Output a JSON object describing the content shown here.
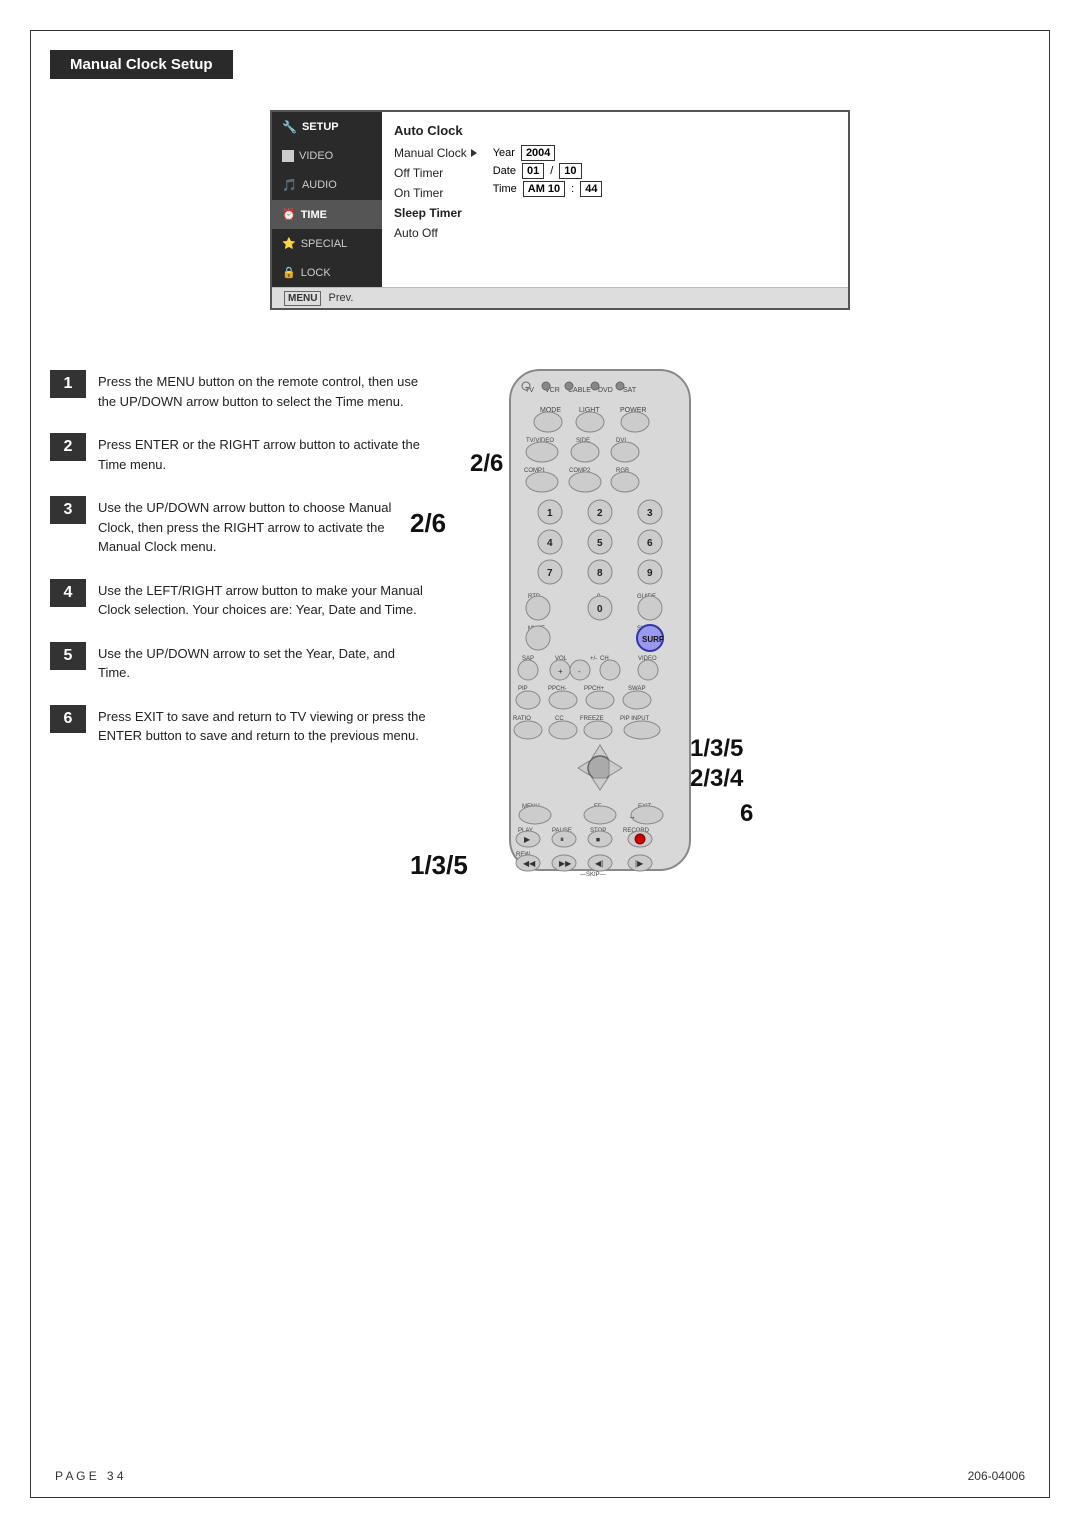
{
  "page": {
    "title": "Manual Clock Setup",
    "footer": {
      "page_label": "P A G E",
      "page_number": "3 4",
      "doc_number": "206-04006"
    }
  },
  "tv_menu": {
    "sidebar_items": [
      {
        "icon": "wrench",
        "label": "SETUP",
        "active": false
      },
      {
        "icon": "square",
        "label": "VIDEO",
        "active": false
      },
      {
        "icon": "audio",
        "label": "AUDIO",
        "active": false
      },
      {
        "icon": "clock",
        "label": "TIME",
        "active": true
      },
      {
        "icon": "special",
        "label": "SPECIAL",
        "active": false
      },
      {
        "icon": "lock",
        "label": "LOCK",
        "active": false
      }
    ],
    "menu_items": [
      {
        "label": "Auto Clock",
        "bold": true,
        "selected": false
      },
      {
        "label": "Manual Clock",
        "bold": false,
        "selected": true,
        "arrow": true
      },
      {
        "label": "Off Timer",
        "bold": false,
        "selected": false
      },
      {
        "label": "On Timer",
        "bold": false,
        "selected": false
      },
      {
        "label": "Sleep Timer",
        "bold": false,
        "selected": false
      },
      {
        "label": "Auto Off",
        "bold": false,
        "selected": false
      }
    ],
    "year_label": "Year",
    "year_value": "2004",
    "date_label": "Date",
    "date_value1": "01",
    "date_sep": "/",
    "date_value2": "10",
    "time_label": "Time",
    "time_am": "AM 10",
    "time_sep": ":",
    "time_min": "44",
    "footer_menu": "MENU",
    "footer_prev": "Prev."
  },
  "steps": [
    {
      "number": "1",
      "text": "Press the MENU button on the remote control, then use the UP/DOWN arrow button to select the Time menu."
    },
    {
      "number": "2",
      "text": "Press ENTER or the RIGHT arrow button to activate the Time menu."
    },
    {
      "number": "3",
      "text": "Use the UP/DOWN arrow button to choose Manual Clock, then press the RIGHT arrow to activate the Manual Clock menu."
    },
    {
      "number": "4",
      "text": "Use the LEFT/RIGHT arrow button to make your Manual Clock selection. Your choices are: Year, Date and Time."
    },
    {
      "number": "5",
      "text": "Use the UP/DOWN arrow to set the Year, Date, and Time."
    },
    {
      "number": "6",
      "text": "Press EXIT to save and return to TV viewing or press the ENTER button to save and return to the previous menu."
    }
  ],
  "remote_labels": {
    "label_26": "2/6",
    "label_4": "4",
    "label_1": "1",
    "label_135": "1/3/5",
    "label_135b": "1/3/5",
    "label_234": "2/3/4",
    "label_6": "6"
  },
  "remote": {
    "source_labels": [
      "TV",
      "VCR",
      "CABLE",
      "DVD",
      "SAT"
    ],
    "top_buttons": [
      "MODE",
      "LIGHT",
      "POWER"
    ],
    "mid_buttons": [
      "TV/VIDEO",
      "SIDE",
      "DVI"
    ],
    "comp_buttons": [
      "COMP1",
      "COMP2",
      "RGB"
    ],
    "numbers": [
      "1",
      "2",
      "3",
      "4",
      "5",
      "6",
      "7",
      "8",
      "9",
      "RTD",
      "0",
      "GUIDE"
    ],
    "mute": "MUTE",
    "surf": "SURF",
    "sap": "SAP",
    "video": "VIDEO",
    "vol_label": "VOL",
    "ch_label": "CH",
    "pip_buttons": [
      "PIP",
      "PPCH-",
      "PPCH+",
      "SWAP"
    ],
    "ratio_row": [
      "RATIO",
      "CC",
      "FREEZE",
      "PIP INPUT"
    ],
    "nav_labels": [
      "MENU",
      "FE",
      "EXIT"
    ],
    "play_labels": [
      "PLAY",
      "PAUSE",
      "STOP",
      "RECORD"
    ],
    "rew_labels": [
      "REW",
      "",
      "",
      ""
    ],
    "skip_label": "SKIP"
  }
}
